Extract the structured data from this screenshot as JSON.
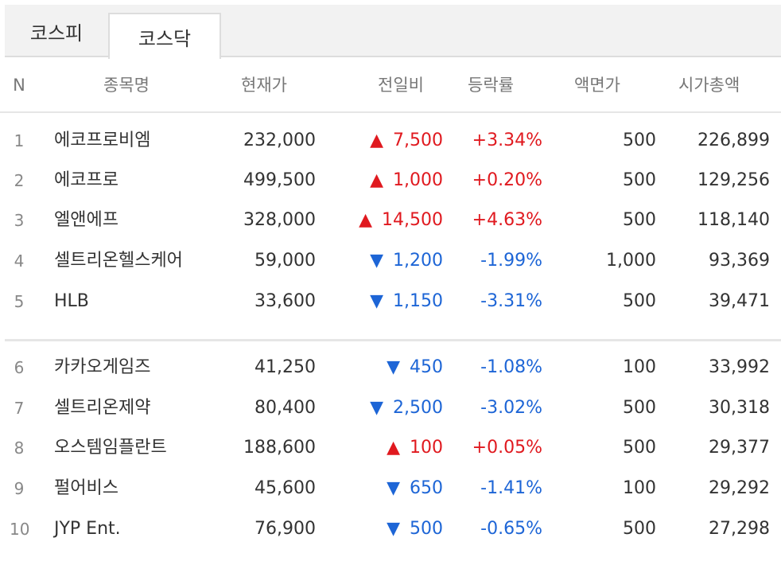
{
  "tabs": [
    "코스피",
    "코스닥"
  ],
  "columns": {
    "n": "N",
    "name": "종목명",
    "price": "현재가",
    "change": "전일비",
    "rate": "등락률",
    "par": "액면가",
    "cap": "시가총액"
  },
  "colors": {
    "up": "#e0191f",
    "down": "#1d65d6"
  },
  "arrows": {
    "up": "▲",
    "down": "▼"
  },
  "rows": [
    {
      "n": "1",
      "name": "에코프로비엠",
      "price": "232,000",
      "dir": "up",
      "change": "7,500",
      "rate": "+3.34%",
      "par": "500",
      "cap": "226,899"
    },
    {
      "n": "2",
      "name": "에코프로",
      "price": "499,500",
      "dir": "up",
      "change": "1,000",
      "rate": "+0.20%",
      "par": "500",
      "cap": "129,256"
    },
    {
      "n": "3",
      "name": "엘앤에프",
      "price": "328,000",
      "dir": "up",
      "change": "14,500",
      "rate": "+4.63%",
      "par": "500",
      "cap": "118,140"
    },
    {
      "n": "4",
      "name": "셀트리온헬스케어",
      "price": "59,000",
      "dir": "down",
      "change": "1,200",
      "rate": "-1.99%",
      "par": "1,000",
      "cap": "93,369"
    },
    {
      "n": "5",
      "name": "HLB",
      "price": "33,600",
      "dir": "down",
      "change": "1,150",
      "rate": "-3.31%",
      "par": "500",
      "cap": "39,471"
    },
    {
      "n": "6",
      "name": "카카오게임즈",
      "price": "41,250",
      "dir": "down",
      "change": "450",
      "rate": "-1.08%",
      "par": "100",
      "cap": "33,992"
    },
    {
      "n": "7",
      "name": "셀트리온제약",
      "price": "80,400",
      "dir": "down",
      "change": "2,500",
      "rate": "-3.02%",
      "par": "500",
      "cap": "30,318"
    },
    {
      "n": "8",
      "name": "오스템임플란트",
      "price": "188,600",
      "dir": "up",
      "change": "100",
      "rate": "+0.05%",
      "par": "500",
      "cap": "29,377"
    },
    {
      "n": "9",
      "name": "펄어비스",
      "price": "45,600",
      "dir": "down",
      "change": "650",
      "rate": "-1.41%",
      "par": "100",
      "cap": "29,292"
    },
    {
      "n": "10",
      "name": "JYP Ent.",
      "price": "76,900",
      "dir": "down",
      "change": "500",
      "rate": "-0.65%",
      "par": "500",
      "cap": "27,298"
    }
  ]
}
